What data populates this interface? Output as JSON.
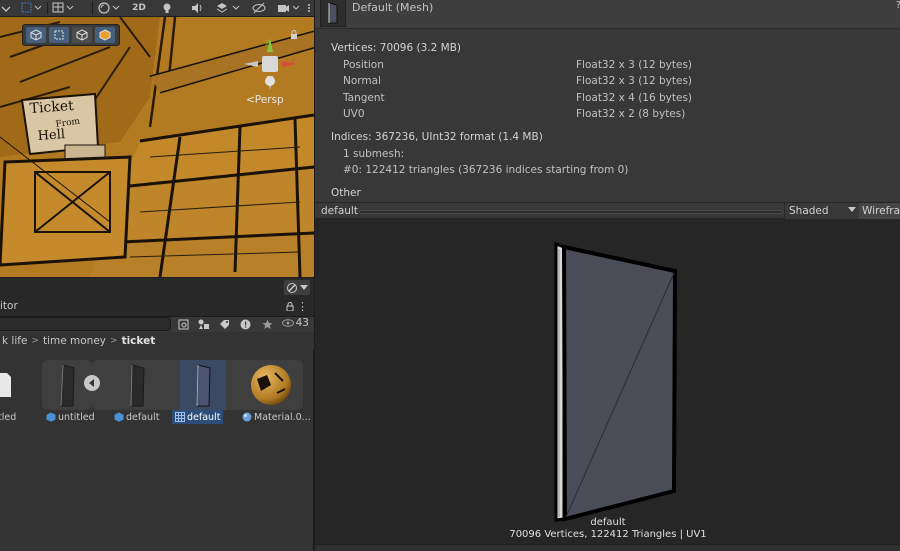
{
  "scene": {
    "toolbar": {
      "mode_2d_label": "2D"
    },
    "persp_label": "<Persp",
    "ticket_sign_text": "Ticket From Hell"
  },
  "project": {
    "tab_label": "itor",
    "hidden_count": "43",
    "breadcrumb": [
      "k life",
      "time money",
      "ticket"
    ],
    "assets": [
      {
        "label": "tled",
        "icon": "file-icon"
      },
      {
        "label": "untitled",
        "icon": "prefab-icon"
      },
      {
        "label": "default",
        "icon": "prefab-icon"
      },
      {
        "label": "default",
        "icon": "mesh-grid-icon",
        "selected": true
      },
      {
        "label": "Material.0...",
        "icon": "material-icon"
      }
    ]
  },
  "inspector": {
    "title": "Default (Mesh)",
    "vertices_header": "Vertices: 70096 (3.2 MB)",
    "attributes": [
      {
        "name": "Position",
        "format": "Float32 x 3 (12 bytes)"
      },
      {
        "name": "Normal",
        "format": "Float32 x 3 (12 bytes)"
      },
      {
        "name": "Tangent",
        "format": "Float32 x 4 (16 bytes)"
      },
      {
        "name": "UV0",
        "format": "Float32 x 2 (8 bytes)"
      }
    ],
    "indices_header": "Indices: 367236, UInt32 format (1.4 MB)",
    "submesh_count": "1 submesh:",
    "submesh_detail": "#0: 122412 triangles (367236 indices starting from 0)",
    "other_label": "Other",
    "preview": {
      "name": "default",
      "shading": "Shaded",
      "wireframe": "Wirefram",
      "caption_name": "default",
      "caption_stats": "70096 Vertices, 122412 Triangles | UV1"
    }
  },
  "colors": {
    "selection": "#2c4e78",
    "scene_tint": "#b07a22",
    "panel_bg": "#383838"
  }
}
